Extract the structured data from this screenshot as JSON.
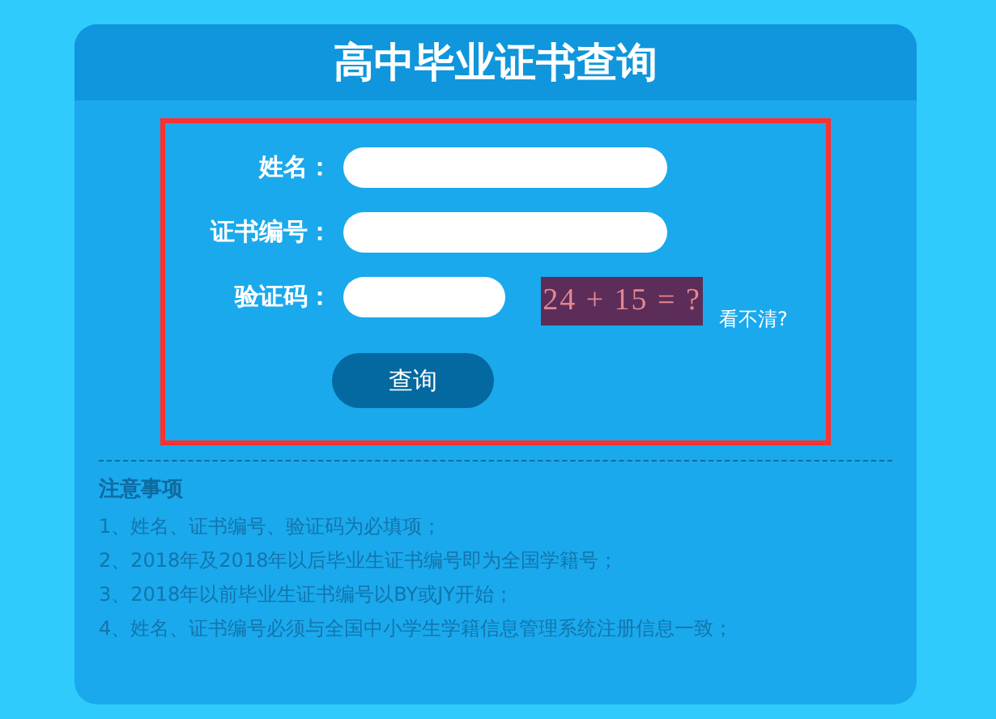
{
  "title": "高中毕业证书查询",
  "form": {
    "fields": [
      {
        "kind": "text",
        "label": "姓名："
      },
      {
        "kind": "text",
        "label": "证书编号："
      },
      {
        "kind": "captcha",
        "label": "验证码：",
        "captcha": "24 + 15 = ?",
        "refresh_link": "看不清?"
      }
    ],
    "submit": "查询"
  },
  "notes": {
    "heading": "注意事项",
    "items": [
      "1、姓名、证书编号、验证码为必填项；",
      "2、2018年及2018年以后毕业生证书编号即为全国学籍号；",
      "3、2018年以前毕业生证书编号以BY或JY开始；",
      "4、姓名、证书编号必须与全国中小学生学籍信息管理系统注册信息一致；"
    ]
  }
}
